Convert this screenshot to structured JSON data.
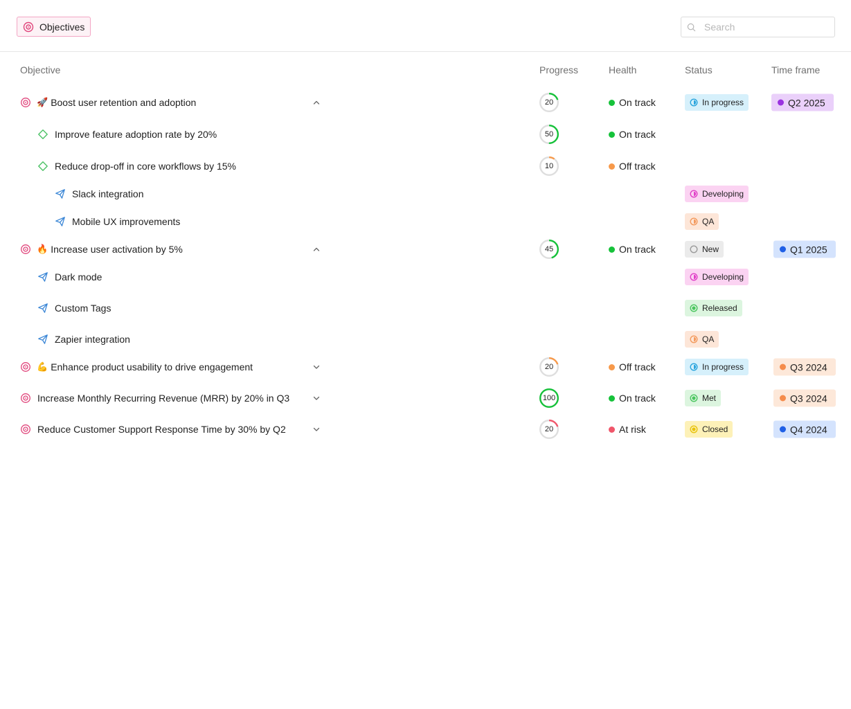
{
  "header": {
    "objectives_label": "Objectives",
    "search_placeholder": "Search"
  },
  "columns": {
    "objective": "Objective",
    "progress": "Progress",
    "health": "Health",
    "status": "Status",
    "timeframe": "Time frame"
  },
  "colors": {
    "on_track": "#16c23a",
    "off_track": "#f7994a",
    "at_risk": "#f0566a",
    "objective_icon": "#e0457b",
    "key_result_icon": "#4dc266",
    "initiative_icon": "#3a86d6"
  },
  "rows": [
    {
      "title": "Boost user retention and adoption",
      "emoji": "🚀",
      "icon": "target-icon",
      "progress": 20,
      "health": "On track",
      "status": "In progress",
      "timeframe": "Q2 2025",
      "expanded": true
    },
    {
      "title": "Improve feature adoption rate by 20%",
      "icon": "diamond-icon",
      "progress": 50,
      "health": "On track"
    },
    {
      "title": "Reduce drop-off in core workflows by 15%",
      "icon": "diamond-icon",
      "progress": 10,
      "health": "Off track"
    },
    {
      "title": "Slack integration",
      "icon": "paper-plane-icon",
      "status": "Developing"
    },
    {
      "title": "Mobile UX improvements",
      "icon": "paper-plane-icon",
      "status": "QA"
    },
    {
      "title": "Increase user activation by 5%",
      "emoji": "🔥",
      "icon": "target-icon",
      "progress": 45,
      "health": "On track",
      "status": "New",
      "timeframe": "Q1 2025",
      "expanded": true
    },
    {
      "title": "Dark mode",
      "icon": "paper-plane-icon",
      "status": "Developing"
    },
    {
      "title": "Custom Tags",
      "icon": "paper-plane-icon",
      "status": "Released"
    },
    {
      "title": "Zapier integration",
      "icon": "paper-plane-icon",
      "status": "QA"
    },
    {
      "title": "Enhance product usability to drive engagement",
      "emoji": "💪",
      "icon": "target-icon",
      "progress": 20,
      "health": "Off track",
      "status": "In progress",
      "timeframe": "Q3 2024",
      "expanded": false
    },
    {
      "title": "Increase Monthly Recurring Revenue (MRR) by 20% in Q3",
      "icon": "target-icon",
      "progress": 100,
      "health": "On track",
      "status": "Met",
      "timeframe": "Q3 2024",
      "expanded": false
    },
    {
      "title": "Reduce Customer Support Response Time by 30% by Q2",
      "icon": "target-icon",
      "progress": 20,
      "health": "At risk",
      "status": "Closed",
      "timeframe": "Q4 2024",
      "expanded": false
    }
  ]
}
